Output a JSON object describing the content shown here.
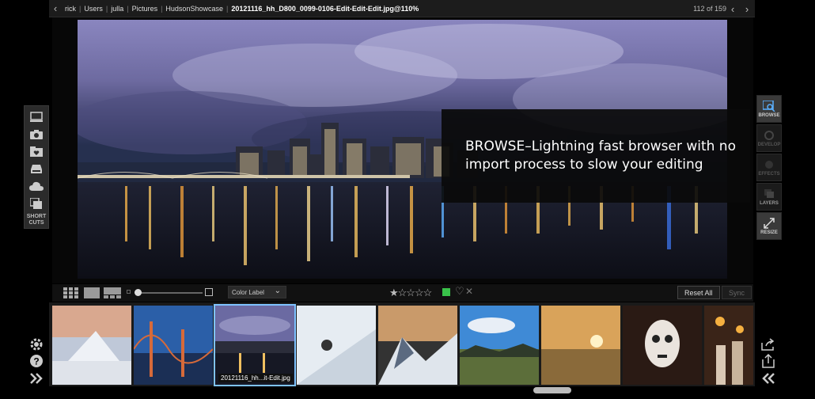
{
  "breadcrumb": [
    "rick",
    "Users",
    "julla",
    "Pictures",
    "HudsonShowcase"
  ],
  "file_name": "20121116_hh_D800_0099-0106-Edit-Edit-Edit.jpg@110%",
  "counter": "112 of 159",
  "caption": "BROWSE–Lightning fast browser with no import process to slow your editing",
  "left_panel": {
    "shortcuts_label_1": "SHORT",
    "shortcuts_label_2": "CUTS",
    "icons": [
      "computer-icon",
      "camera-icon",
      "favorites-icon",
      "drive-icon",
      "cloud-icon",
      "shortcuts-icon"
    ]
  },
  "right_panel": {
    "browse_label": "BROWSE",
    "develop_label": "DEVELOP",
    "effects_label": "EFFECTS",
    "layers_label": "LAYERS",
    "resize_label": "RESIZE"
  },
  "filmbar": {
    "color_label": "Color Label",
    "stars": "★☆☆☆☆",
    "rating": 1,
    "reset_label": "Reset All",
    "sync_label": "Sync"
  },
  "filmstrip": {
    "selected_label": "20121116_hh...it-Edit.jpg"
  },
  "colors": {
    "accent_selection": "#7fc3ff",
    "green_label": "#39c24a"
  }
}
